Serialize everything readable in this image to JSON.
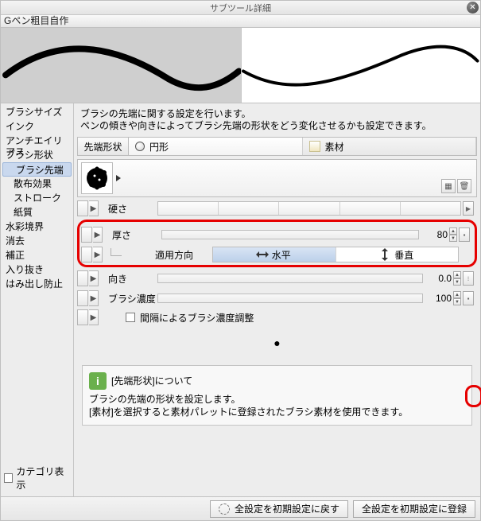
{
  "window_title": "サブツール詳細",
  "tool_name": "Gペン粗目自作",
  "sidebar": {
    "items": [
      {
        "label": "ブラシサイズ"
      },
      {
        "label": "インク"
      },
      {
        "label": "アンチエイリアス"
      },
      {
        "label": "ブラシ形状"
      },
      {
        "label": "ブラシ先端",
        "indent": true,
        "selected": true
      },
      {
        "label": "散布効果",
        "indent": true
      },
      {
        "label": "ストローク",
        "indent": true
      },
      {
        "label": "紙質",
        "indent": true
      },
      {
        "label": "水彩境界"
      },
      {
        "label": "消去"
      },
      {
        "label": "補正"
      },
      {
        "label": "入り抜き"
      },
      {
        "label": "はみ出し防止"
      }
    ],
    "category_label": "カテゴリ表示"
  },
  "description_line1": "ブラシの先端に関する設定を行います。",
  "description_line2": "ペンの傾きや向きによってブラシ先端の形状をどう変化させるかも設定できます。",
  "tip_shape": {
    "label": "先端形状",
    "option1": "円形",
    "option2": "素材"
  },
  "params": {
    "hardness": {
      "label": "硬さ"
    },
    "thickness": {
      "label": "厚さ",
      "value": "80"
    },
    "apply_dir": {
      "label": "適用方向",
      "h": "水平",
      "v": "垂直"
    },
    "direction": {
      "label": "向き",
      "value": "0.0"
    },
    "density": {
      "label": "ブラシ濃度",
      "value": "100"
    },
    "density_gap": {
      "label": "間隔によるブラシ濃度調整"
    }
  },
  "info": {
    "title": "[先端形状]について",
    "line1": "ブラシの先端の形状を設定します。",
    "line2": "[素材]を選択すると素材パレットに登録されたブラシ素材を使用できます。"
  },
  "footer": {
    "reset": "全設定を初期設定に戻す",
    "register": "全設定を初期設定に登録"
  }
}
